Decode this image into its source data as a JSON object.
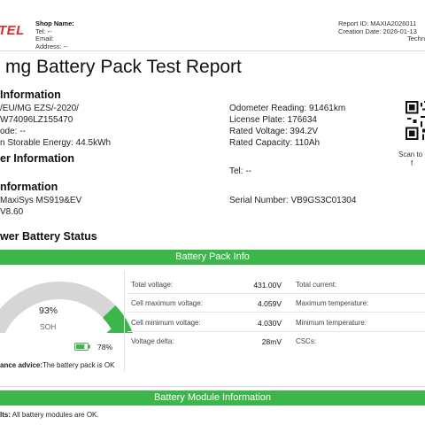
{
  "header": {
    "logo": "TEL",
    "shop_name": "Shop Name:",
    "tel": "Tel:  --",
    "email": "Email:",
    "address": "Address:  --",
    "report_id": "Report ID:  MAXIA2026011",
    "creation_date": "Creation Date:  2026-01-13",
    "technician": "Techn"
  },
  "title": "mg Battery Pack Test Report",
  "vehicle": {
    "heading": "Information",
    "model": "/EU/MG EZS/-2020/",
    "vin": "W74096LZ155470",
    "code": "ode: --",
    "storable_energy": "n Storable Energy: 44.5kWh",
    "odometer": "Odometer Reading: 91461km",
    "license_plate": "License Plate: 176634",
    "rated_voltage": "Rated Voltage: 394.2V",
    "rated_capacity": "Rated Capacity: 110Ah"
  },
  "customer": {
    "heading": "er Information",
    "tel": "Tel: --"
  },
  "device": {
    "heading": "nformation",
    "name": "MaxiSys MS919&EV",
    "version": "V8.60",
    "serial": "Serial Number: VB9GS3C01304"
  },
  "qr": {
    "caption_line1": "Scan to",
    "caption_line2": "f"
  },
  "battery_status": {
    "heading": "wer Battery Status",
    "bar_label": "Battery Pack Info",
    "soh_value": "93%",
    "soh_label": "SOH",
    "soh_fraction": 0.93,
    "charge_pct": "78%",
    "charge_fraction": 0.78,
    "advice_label": "ance advice:",
    "advice_text": "The battery pack is OK",
    "rows": [
      {
        "label": "Total voltage:",
        "value": "431.00V",
        "label2": "Total current:"
      },
      {
        "label": "Cell maximum voltage:",
        "value": "4.059V",
        "label2": "Maximum temperature:"
      },
      {
        "label": "Cell minimum voltage:",
        "value": "4.030V",
        "label2": "Minimum temperature:"
      },
      {
        "label": "Voltage delta:",
        "value": "28mV",
        "label2": "CSCs:"
      }
    ]
  },
  "module": {
    "bar_label": "Battery Module Information",
    "result_label": "lts:",
    "result_text": "All battery modules are OK."
  },
  "colors": {
    "accent_green": "#3cb54a",
    "logo_red": "#e02a2a",
    "gauge_track": "#d6d6d6"
  }
}
